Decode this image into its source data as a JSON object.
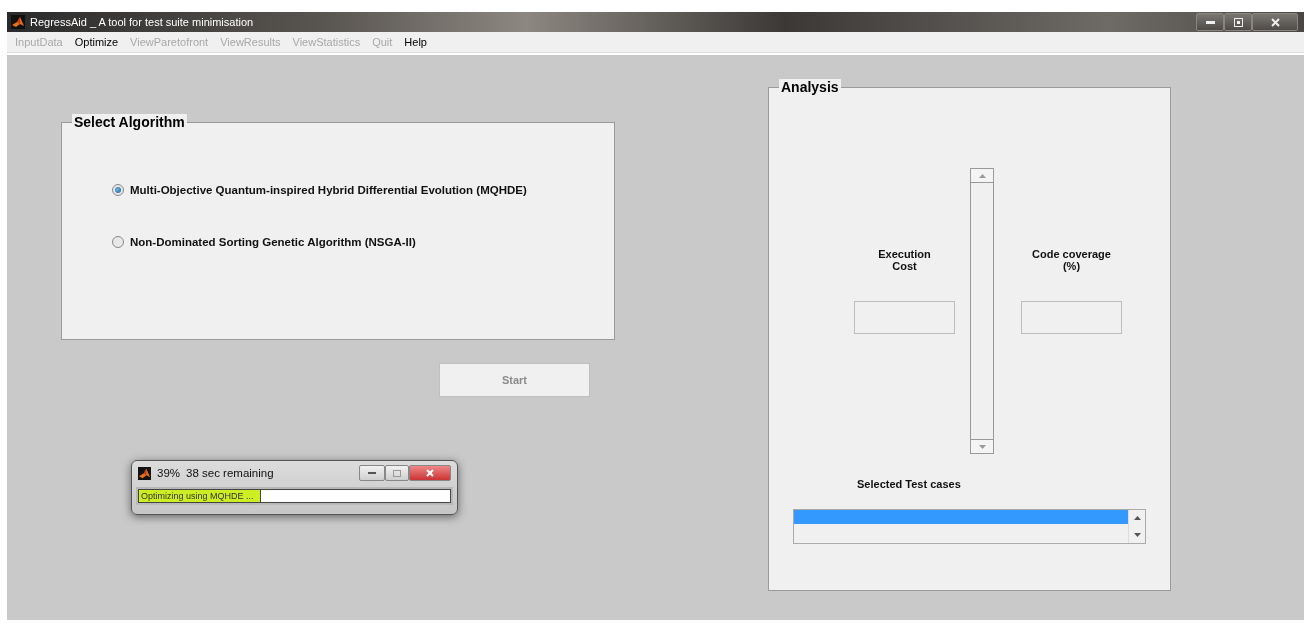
{
  "window": {
    "title": "RegressAid _ A tool for test suite minimisation"
  },
  "menu": [
    {
      "label": "InputData",
      "disabled": true
    },
    {
      "label": "Optimize",
      "disabled": false
    },
    {
      "label": "ViewParetofront",
      "disabled": true
    },
    {
      "label": "ViewResults",
      "disabled": true
    },
    {
      "label": "ViewStatistics",
      "disabled": true
    },
    {
      "label": "Quit",
      "disabled": true
    },
    {
      "label": "Help",
      "disabled": false
    }
  ],
  "algorithm_panel": {
    "title": "Select Algorithm",
    "options": [
      {
        "label": "Multi-Objective Quantum-inspired Hybrid Differential Evolution (MQHDE)",
        "selected": true
      },
      {
        "label": "Non-Dominated Sorting Genetic Algorithm (NSGA-II)",
        "selected": false
      }
    ]
  },
  "start_button": {
    "label": "Start",
    "disabled": true
  },
  "analysis_panel": {
    "title": "Analysis",
    "slider": {
      "disabled": true
    },
    "execution_cost_label": "Execution\nCost",
    "code_coverage_label": "Code coverage\n(%)",
    "selected_label": "Selected Test cases",
    "test_case_rows": [
      {
        "selected": true
      },
      {
        "selected": false
      }
    ]
  },
  "progress_dialog": {
    "percent": "39%",
    "remaining": "38 sec remaining",
    "message": "Optimizing using MQHDE ...",
    "level": 0.39
  }
}
